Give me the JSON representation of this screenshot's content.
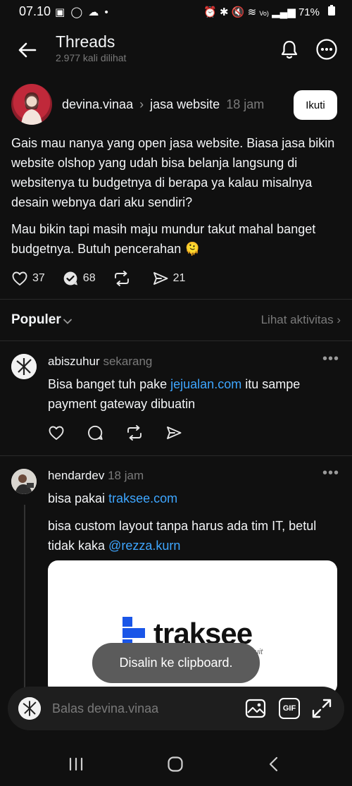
{
  "status_bar": {
    "time": "07.10",
    "battery": "71%",
    "left_icons": [
      "gallery-icon",
      "whatsapp-icon",
      "cloud-icon",
      "dot-icon"
    ],
    "right_icons": [
      "alarm-icon",
      "bluetooth-icon",
      "mute-icon",
      "wifi-icon",
      "volte-icon",
      "signal-icon"
    ]
  },
  "header": {
    "title": "Threads",
    "views": "2.977 kali dilihat"
  },
  "post": {
    "username": "devina.vinaa",
    "topic": "jasa website",
    "time": "18 jam",
    "follow_label": "Ikuti",
    "paragraph1": "Gais mau nanya yang open jasa website. Biasa jasa bikin website olshop yang udah bisa belanja langsung di websitenya tu budgetnya di berapa ya kalau misalnya desain webnya dari aku sendiri?",
    "paragraph2": "Mau bikin tapi masih maju mundur takut mahal banget budgetnya. Butuh pencerahan",
    "emoji": "🫠",
    "likes": "37",
    "replies": "68",
    "shares": "21"
  },
  "sort": {
    "label": "Populer",
    "activity_link": "Lihat aktivitas"
  },
  "replies": [
    {
      "username": "abiszuhur",
      "time": "sekarang",
      "text_before": "Bisa banget tuh pake ",
      "link": "jejualan.com",
      "text_after": " itu sampe payment gateway dibuatin"
    },
    {
      "username": "hendardev",
      "time": "18 jam",
      "text_before": "bisa pakai ",
      "link": "traksee.com",
      "text2_before": "bisa custom layout tanpa harus ada tim IT, betul tidak kaka ",
      "mention": "@rezza.kurn",
      "card_brand": "traksee",
      "card_tagline": "by Bzuit"
    }
  ],
  "toast": "Disalin ke clipboard.",
  "reply_bar": {
    "placeholder": "Balas devina.vinaa",
    "gif_label": "GIF"
  }
}
